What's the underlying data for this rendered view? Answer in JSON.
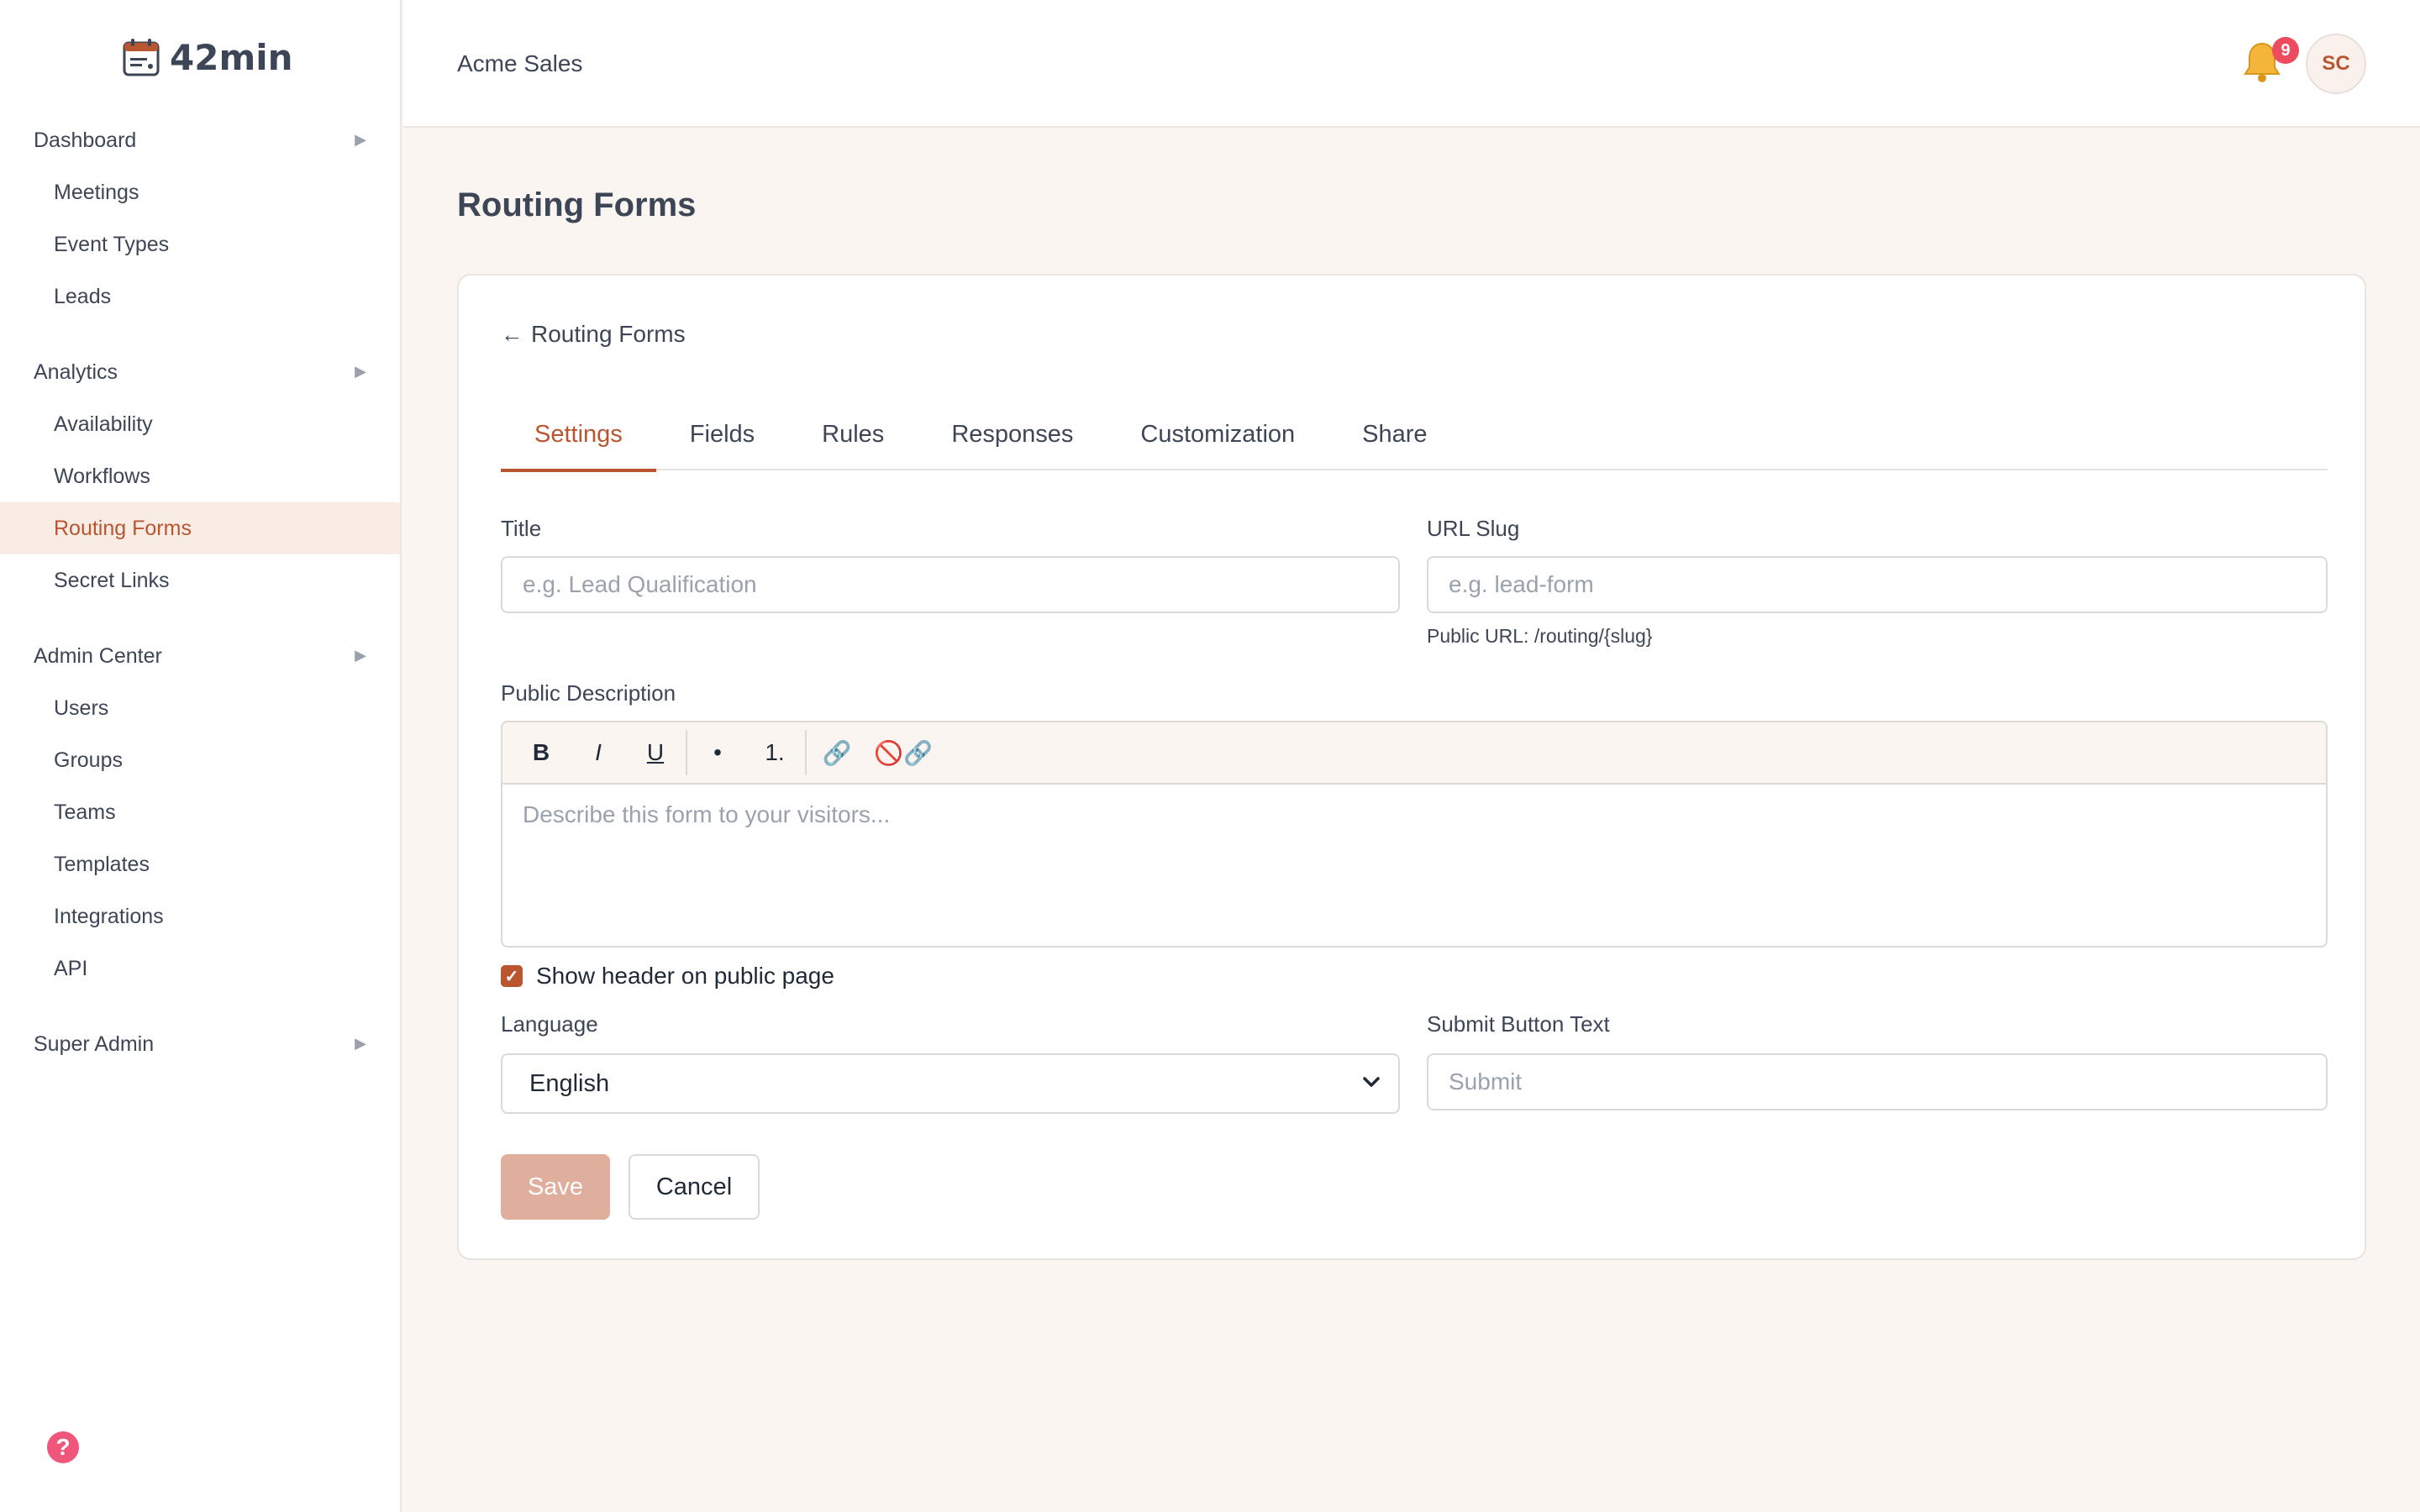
{
  "brand": {
    "name": "42min",
    "logo_icon": "calendar-icon",
    "accent": "#b9552f"
  },
  "sidebar": {
    "sections": [
      {
        "label": "Dashboard",
        "items": [
          {
            "label": "Meetings"
          },
          {
            "label": "Event Types"
          },
          {
            "label": "Leads"
          }
        ]
      },
      {
        "label": "Analytics",
        "items": [
          {
            "label": "Availability"
          },
          {
            "label": "Workflows"
          },
          {
            "label": "Routing Forms",
            "active": true
          },
          {
            "label": "Secret Links"
          }
        ]
      },
      {
        "label": "Admin Center",
        "items": [
          {
            "label": "Users"
          },
          {
            "label": "Groups"
          },
          {
            "label": "Teams"
          },
          {
            "label": "Templates"
          },
          {
            "label": "Integrations"
          },
          {
            "label": "API"
          }
        ]
      },
      {
        "label": "Super Admin",
        "items": []
      }
    ],
    "caret_glyph": "▶",
    "help_glyph": "?"
  },
  "header": {
    "org_name": "Acme Sales",
    "notifications_count": "9",
    "avatar_initials": "SC"
  },
  "page": {
    "title": "Routing Forms",
    "back_arrow": "←",
    "back_label": "Routing Forms",
    "tabs": [
      {
        "label": "Settings",
        "active": true
      },
      {
        "label": "Fields"
      },
      {
        "label": "Rules"
      },
      {
        "label": "Responses"
      },
      {
        "label": "Customization"
      },
      {
        "label": "Share"
      }
    ]
  },
  "form": {
    "title_label": "Title",
    "title_placeholder": "e.g. Lead Qualification",
    "slug_label": "URL Slug",
    "slug_placeholder": "e.g. lead-form",
    "slug_hint": "Public URL: /routing/{slug}",
    "description_label": "Public Description",
    "description_placeholder": "Describe this form to your visitors...",
    "toolbar": {
      "bold": "B",
      "italic": "I",
      "underline": "U",
      "bullet": "•",
      "numbered": "1.",
      "link": "🔗",
      "unlink": "🚫🔗"
    },
    "show_header_label": "Show header on public page",
    "show_header_checked": true,
    "language_label": "Language",
    "language_value": "English",
    "submit_label": "Submit Button Text",
    "submit_placeholder": "Submit",
    "save_label": "Save",
    "cancel_label": "Cancel"
  }
}
